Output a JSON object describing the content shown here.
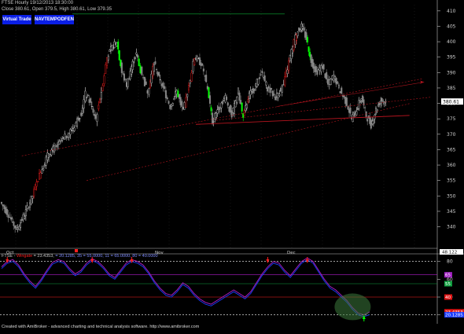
{
  "header": {
    "line1": "FTSE Hourly 19/12/2013 18:30:00",
    "line2": "Close 380.61, Open 379.5, High 380.61, Low 379.35"
  },
  "buttons": {
    "virtual_trade": "Virtual Trade",
    "second": "NAVTEMPODFEN"
  },
  "indicator": {
    "title_prefix": "FTSE - ",
    "title_name": "Wingate",
    "title_rest": " = 23.4353, ",
    "title_sig": "= 20.1285, 35 = 55.0000, 11 = 65.0000, 80 = 40.0000"
  },
  "footer": "Created with AmiBroker - advanced charting and technical analysis software. http://www.amibroker.com",
  "colors": {
    "bull": "#d8d8d8",
    "bear": "#888888",
    "red": "#ff1e1e",
    "green": "#00ff00",
    "blue": "#1a3cff",
    "purple": "#b01cc8",
    "trend": "#b4141e",
    "level65": "#b01cc8",
    "level55": "#0fa040"
  },
  "price_axis": {
    "ticks": [
      410,
      405,
      400,
      395,
      390,
      385,
      380,
      375,
      370,
      365,
      360,
      355,
      350,
      345,
      340
    ],
    "last_price": "380.61",
    "last_price_color": "#000000",
    "last_price_bg": "#ffffff"
  },
  "indicator_axis": {
    "ticks": [
      80,
      60,
      40,
      20
    ],
    "top_label": "48.122",
    "badges": [
      {
        "text": "65",
        "bg": "#a020c0",
        "value": 65
      },
      {
        "text": "55",
        "bg": "#10a040",
        "value": 55
      },
      {
        "text": "40",
        "bg": "#e01414",
        "value": 40
      },
      {
        "text": "23.4353",
        "bg": "#e01414",
        "value": 23.4353
      },
      {
        "text": "20.1285",
        "bg": "#1a3cff",
        "value": 20.1285
      }
    ]
  },
  "x_labels": [
    "Oct",
    "Nov",
    "Dec"
  ],
  "chart_data": {
    "type": "candlestick",
    "price": {
      "ylim": [
        333,
        412
      ],
      "points": [
        [
          0,
          348
        ],
        [
          10,
          344
        ],
        [
          20,
          339
        ],
        [
          30,
          344
        ],
        [
          40,
          350
        ],
        [
          50,
          358
        ],
        [
          60,
          364
        ],
        [
          70,
          366
        ],
        [
          80,
          369
        ],
        [
          90,
          372
        ],
        [
          100,
          377
        ],
        [
          105,
          383
        ],
        [
          110,
          381
        ],
        [
          118,
          375
        ],
        [
          125,
          384
        ],
        [
          132,
          395
        ],
        [
          138,
          398
        ],
        [
          144,
          400
        ],
        [
          150,
          390
        ],
        [
          156,
          386
        ],
        [
          162,
          392
        ],
        [
          168,
          396
        ],
        [
          175,
          389
        ],
        [
          182,
          384
        ],
        [
          190,
          393
        ],
        [
          196,
          388
        ],
        [
          203,
          384
        ],
        [
          210,
          379
        ],
        [
          218,
          384
        ],
        [
          226,
          377
        ],
        [
          233,
          386
        ],
        [
          240,
          395
        ],
        [
          248,
          393
        ],
        [
          256,
          385
        ],
        [
          262,
          374
        ],
        [
          270,
          379
        ],
        [
          278,
          382
        ],
        [
          286,
          376
        ],
        [
          294,
          384
        ],
        [
          300,
          375
        ],
        [
          306,
          382
        ],
        [
          314,
          385
        ],
        [
          322,
          390
        ],
        [
          330,
          385
        ],
        [
          340,
          382
        ],
        [
          350,
          386
        ],
        [
          358,
          395
        ],
        [
          366,
          403
        ],
        [
          372,
          405
        ],
        [
          378,
          401
        ],
        [
          384,
          394
        ],
        [
          390,
          390
        ],
        [
          398,
          392
        ],
        [
          405,
          386
        ],
        [
          412,
          389
        ],
        [
          420,
          384
        ],
        [
          428,
          380
        ],
        [
          434,
          375
        ],
        [
          440,
          378
        ],
        [
          446,
          382
        ],
        [
          452,
          376
        ],
        [
          458,
          373
        ],
        [
          464,
          378
        ],
        [
          470,
          381
        ],
        [
          476,
          380.61
        ]
      ],
      "trendlines": [
        {
          "from": [
            240,
            373.2
          ],
          "to": [
            504,
            376.1
          ]
        },
        {
          "from": [
            340,
            379
          ],
          "to": [
            522,
            386.9
          ]
        },
        {
          "from": [
            105,
            355
          ],
          "to": [
            505,
            380
          ]
        },
        {
          "from": [
            265,
            374.5
          ],
          "to": [
            530,
            382
          ]
        },
        {
          "from": [
            25,
            363
          ],
          "to": [
            520,
            388
          ]
        }
      ],
      "green_line": {
        "value": 409,
        "from_x": 92,
        "to_x": 362
      }
    },
    "indicator": {
      "ylim": [
        10,
        85
      ],
      "levels": [
        {
          "value": 80,
          "color": "#ffffff",
          "dash": true
        },
        {
          "value": 65,
          "color": "#b01cc8"
        },
        {
          "value": 55,
          "color": "#0fa040"
        },
        {
          "value": 40,
          "color": "#ff1e1e"
        },
        {
          "value": 20,
          "color": "#ffffff",
          "dash": true
        }
      ],
      "series": [
        {
          "color": "#b01cc8",
          "values": [
            74,
            80,
            82,
            76,
            66,
            58,
            52,
            60,
            70,
            79,
            82,
            80,
            72,
            66,
            70,
            78,
            83,
            80,
            74,
            66,
            62,
            70,
            78,
            82,
            80,
            76,
            68,
            58,
            50,
            44,
            42,
            48,
            56,
            52,
            44,
            38,
            34,
            32,
            36,
            40,
            44,
            48,
            44,
            40,
            46,
            56,
            66,
            74,
            80,
            78,
            70,
            64,
            72,
            80,
            84,
            80,
            70,
            60,
            52,
            48,
            42,
            36,
            28,
            22,
            20,
            23.4353
          ]
        },
        {
          "color": "#1a3cff",
          "values": [
            72,
            78,
            80,
            74,
            64,
            56,
            50,
            58,
            68,
            77,
            80,
            78,
            70,
            64,
            68,
            76,
            81,
            78,
            72,
            64,
            60,
            68,
            76,
            80,
            78,
            74,
            66,
            56,
            48,
            42,
            40,
            46,
            54,
            50,
            42,
            36,
            32,
            30,
            34,
            38,
            42,
            46,
            42,
            38,
            44,
            54,
            64,
            72,
            78,
            76,
            68,
            62,
            70,
            78,
            82,
            78,
            68,
            58,
            50,
            46,
            40,
            34,
            26,
            20,
            18,
            20.1285
          ]
        }
      ],
      "signals": [
        {
          "i": 1,
          "dir": "down"
        },
        {
          "i": 16,
          "dir": "down"
        },
        {
          "i": 23,
          "dir": "down"
        },
        {
          "i": 47,
          "dir": "down"
        },
        {
          "i": 54,
          "dir": "down"
        },
        {
          "i": 64,
          "dir": "up"
        }
      ],
      "highlight": {
        "i": 62,
        "value": 22
      }
    }
  }
}
